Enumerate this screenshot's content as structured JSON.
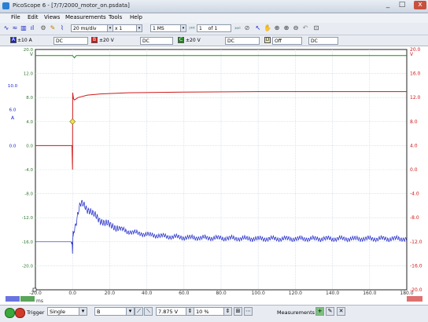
{
  "window": {
    "title": "PicoScope 6 - [7/7/2000_motor_on.psdata]",
    "controls": {
      "minimize": "_",
      "maximize": "□",
      "close": "x"
    }
  },
  "menu": [
    "File",
    "Edit",
    "Views",
    "Measurements",
    "Tools",
    "Help"
  ],
  "toolbar": {
    "timebase": "20 ms/div",
    "zoom": "x 1",
    "samples": "1 MS",
    "buffer": "1",
    "buffer_of": "of 1"
  },
  "channels": [
    {
      "letter": "A",
      "range": "±10 A",
      "coupling": "DC",
      "color": "#1a24c8"
    },
    {
      "letter": "B",
      "range": "±20 V",
      "coupling": "DC",
      "color": "#d01818"
    },
    {
      "letter": "C",
      "range": "±20 V",
      "coupling": "DC",
      "color": "#1a8a1a"
    },
    {
      "letter": "D",
      "range": "Off",
      "coupling": "DC",
      "color": "#d4c000"
    }
  ],
  "branding": {
    "logo": "pico",
    "sub": "Technology"
  },
  "chart_data": {
    "type": "line",
    "x_axis": {
      "unit": "ms",
      "min": -20,
      "max": 180,
      "ticks": [
        "-20.0",
        "0.0",
        "20.0",
        "40.0",
        "60.0",
        "80.0",
        "100.0",
        "120.0",
        "140.0",
        "160.0",
        "180.0"
      ]
    },
    "left_axis_A": {
      "unit": "A",
      "min": -10,
      "max": 10,
      "ticks": [
        "10.0",
        "6.0",
        "0.0"
      ]
    },
    "left_axis_C": {
      "unit": "V",
      "min": -20,
      "max": 20,
      "ticks": [
        "20.0",
        "12.0",
        "8.0",
        "4.0",
        "0.0",
        "-4.0",
        "-8.0",
        "-12.0",
        "-16.0",
        "-20.0"
      ]
    },
    "left_axis_C_vals": [
      "12.0",
      "8.0",
      "4.0",
      "0.0",
      "-4.0",
      "-8.0",
      "-12.0",
      "-16.0",
      "-20.0",
      "-4.0"
    ],
    "left_labels_black": [
      "12.0",
      "8.0",
      "4.0",
      "4.0",
      "-4.0",
      "-8.0",
      "12.0",
      "10.0",
      "-16.0",
      "-20.0",
      "-4.0"
    ],
    "right_axis_B": {
      "unit": "V",
      "min": -20,
      "max": 20,
      "ticks": [
        "20.0",
        "16.0",
        "12.0",
        "8.0",
        "4.0",
        "0.0",
        "-4.0",
        "-8.0",
        "-12.0",
        "-16.0",
        "-20.0"
      ]
    },
    "grid": true,
    "series": [
      {
        "name": "A",
        "color": "#1a24c8",
        "points": [
          [
            -20,
            -12.0
          ],
          [
            -0.5,
            -12.0
          ],
          [
            0,
            -14.0
          ],
          [
            0.4,
            -10.2
          ],
          [
            1,
            -9.8
          ],
          [
            2,
            -8.8
          ],
          [
            3,
            -7.2
          ],
          [
            4,
            -6.0
          ],
          [
            5,
            -5.6
          ],
          [
            6,
            -5.8
          ],
          [
            7,
            -6.2
          ],
          [
            8,
            -6.6
          ],
          [
            10,
            -7.0
          ],
          [
            12,
            -7.6
          ],
          [
            15,
            -8.5
          ],
          [
            20,
            -9.2
          ],
          [
            25,
            -9.8
          ],
          [
            30,
            -10.3
          ],
          [
            40,
            -10.8
          ],
          [
            50,
            -11.1
          ],
          [
            60,
            -11.3
          ],
          [
            80,
            -11.4
          ],
          [
            100,
            -11.5
          ],
          [
            140,
            -11.5
          ],
          [
            180,
            -11.5
          ]
        ]
      },
      {
        "name": "B",
        "color": "#d01818",
        "points": [
          [
            -20,
            4.0
          ],
          [
            -0.3,
            4.0
          ],
          [
            0,
            0.0
          ],
          [
            0.1,
            12.8
          ],
          [
            0.5,
            11.8
          ],
          [
            1,
            11.6
          ],
          [
            3,
            12.0
          ],
          [
            8,
            12.4
          ],
          [
            15,
            12.6
          ],
          [
            30,
            12.8
          ],
          [
            60,
            12.9
          ],
          [
            100,
            13.0
          ],
          [
            180,
            13.0
          ]
        ]
      },
      {
        "name": "C",
        "color": "#1a8a1a",
        "points": [
          [
            -20,
            19.0
          ],
          [
            0,
            19.0
          ],
          [
            1,
            18.6
          ],
          [
            2,
            19.0
          ],
          [
            180,
            19.0
          ]
        ]
      }
    ],
    "trigger_marker": {
      "x": 0,
      "y": 8.0
    }
  },
  "axes_text": {
    "unit_x": "ms",
    "unit_A": "A",
    "unit_C": "V",
    "unit_B": "V",
    "unit_top_right": "V"
  },
  "status": {
    "trigger_label": "Trigger",
    "trigger_mode": "Single",
    "trigger_channel": "B",
    "threshold": "7.875 V",
    "pretrigger": "10 %",
    "measurements_label": "Measurements"
  }
}
